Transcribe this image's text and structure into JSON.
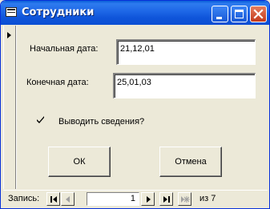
{
  "window": {
    "title": "Сотрудники",
    "icon": "form-icon",
    "controls": [
      "minimize-icon",
      "maximize-icon",
      "close-icon"
    ]
  },
  "form": {
    "start_date": {
      "label": "Начальная дата:",
      "value": "21,12,01"
    },
    "end_date": {
      "label": "Конечная дата:",
      "value": "25,01,03"
    },
    "show_info": {
      "label": "Выводить сведения?",
      "checked": true
    },
    "ok_label": "ОК",
    "cancel_label": "Отмена"
  },
  "navigation": {
    "label": "Запись:",
    "current": "1",
    "total_text": "из  7",
    "buttons": [
      "first-record-icon",
      "prev-record-icon",
      "next-record-icon",
      "last-record-icon",
      "new-record-icon"
    ]
  },
  "colors": {
    "titlebar": "#0B4FD3",
    "window_bg": "#ECE9D8",
    "close_button": "#C3391A"
  }
}
